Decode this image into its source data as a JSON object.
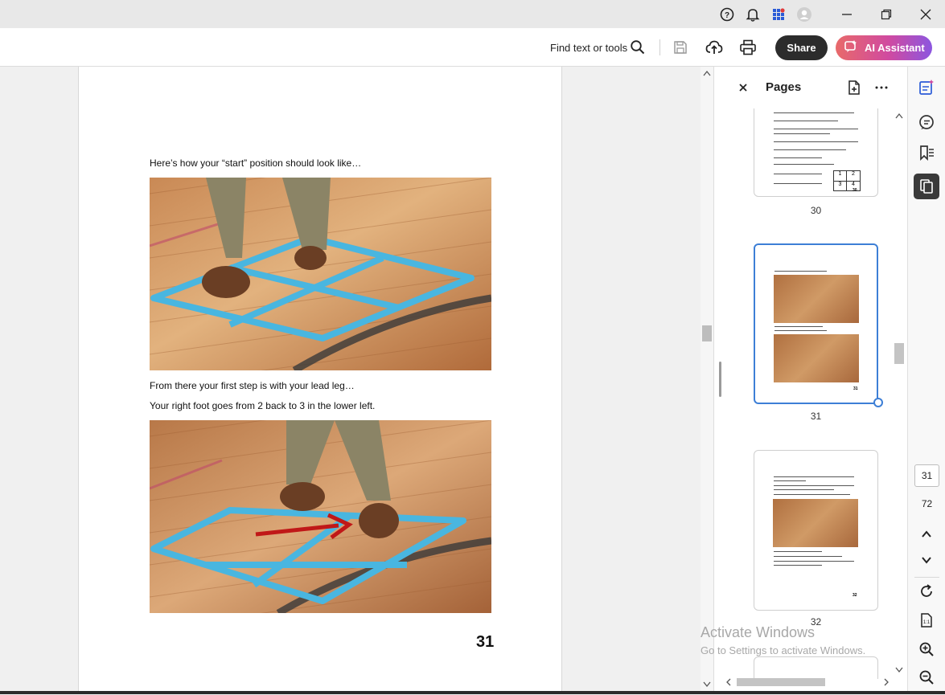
{
  "toolbar": {
    "find_label": "Find text or tools",
    "share_label": "Share",
    "ai_label": "AI Assistant"
  },
  "document": {
    "caption_start": "Here’s how your “start” position should look like…",
    "caption_step1": "From there your first step is with your lead leg…",
    "caption_step2": "Your right foot goes from 2 back to 3 in the lower left.",
    "page_number": "31"
  },
  "pages_panel": {
    "title": "Pages",
    "thumbnails": [
      {
        "label": "30"
      },
      {
        "label": "31"
      },
      {
        "label": "32"
      }
    ],
    "grid_numbers": [
      "1",
      "2",
      "3",
      "4"
    ],
    "thumb_page_numbers": [
      "30",
      "31",
      "32"
    ]
  },
  "nav": {
    "current_page": "31",
    "total_pages": "72"
  },
  "watermark": {
    "line1": "Activate Windows",
    "line2": "Go to Settings to activate Windows."
  },
  "colors": {
    "share_bg": "#2c2c2c",
    "selection": "#3d7fd6",
    "tape": "#4fb6dc",
    "floor": "#c68a55"
  }
}
